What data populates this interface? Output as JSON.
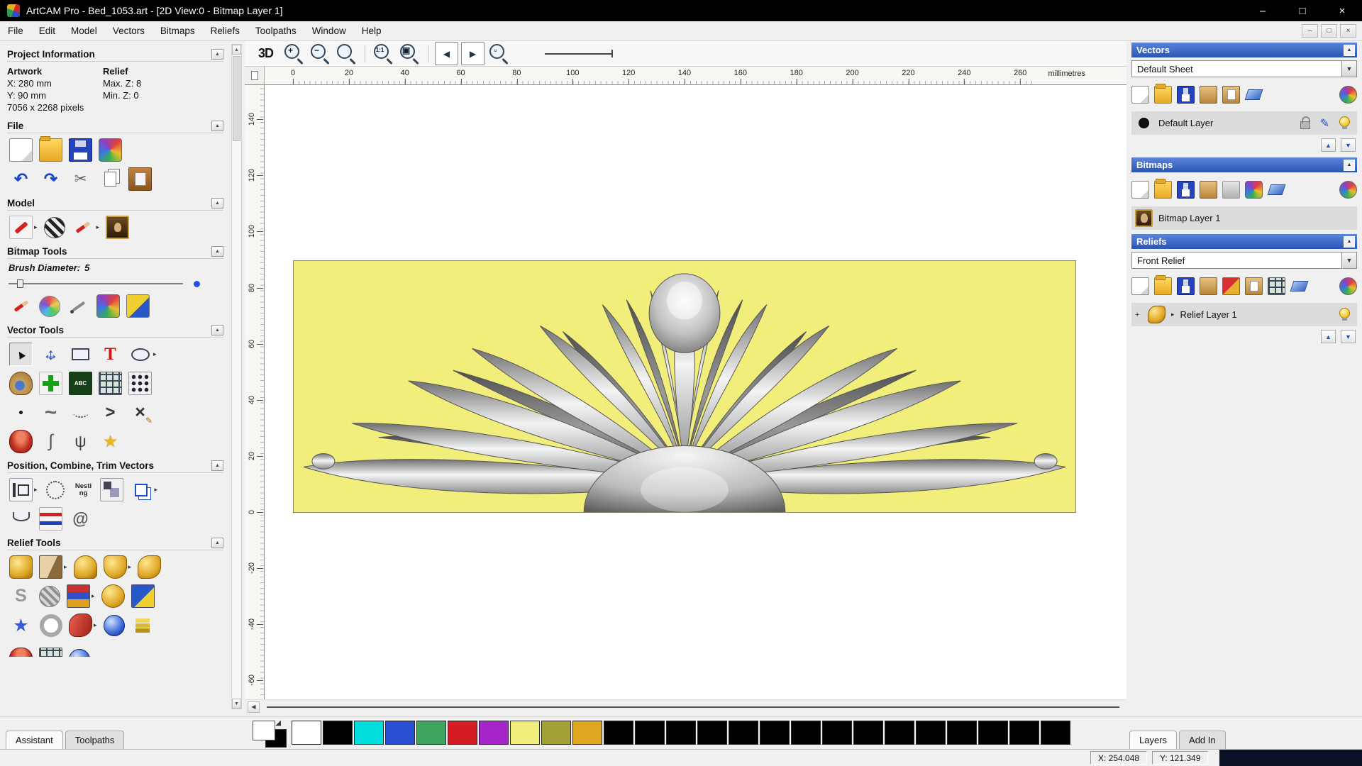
{
  "window": {
    "title": "ArtCAM Pro - Bed_1053.art - [2D View:0 - Bitmap Layer 1]",
    "menu_items": [
      "File",
      "Edit",
      "Model",
      "Vectors",
      "Bitmaps",
      "Reliefs",
      "Toolpaths",
      "Window",
      "Help"
    ]
  },
  "left_panel": {
    "project_info": {
      "title": "Project Information",
      "artwork_label": "Artwork",
      "relief_label": "Relief",
      "x": "X: 280 mm",
      "y": "Y: 90 mm",
      "max_z": "Max. Z: 8",
      "min_z": "Min. Z: 0",
      "pixels": "7056 x 2268 pixels"
    },
    "file": {
      "title": "File",
      "rows": [
        [
          "new-model:page",
          "open-model:folder",
          "save-model:floppy",
          "import-export:colorful"
        ],
        [
          "undo:undo",
          "redo:redo",
          "cut:cut",
          "copy:copy",
          "paste:paste"
        ]
      ]
    },
    "model": {
      "title": "Model",
      "rows": [
        [
          "set-model-size:redtool:arrow",
          "model-lighting:chess",
          "paint-from-model:brushred:arrow",
          "face-wizard:portrait"
        ]
      ]
    },
    "bitmap_tools": {
      "title": "Bitmap Tools",
      "brush_label": "Brush Diameter:",
      "brush_value": "5",
      "rows": [
        [
          "paint-brush:brushred",
          "draw-colour:palette",
          "colour-picker:dropper",
          "edit-palette:colorful",
          "flood-fill:bucket"
        ]
      ]
    },
    "vector_tools": {
      "title": "Vector Tools",
      "rows": [
        [
          "select-vectors:cursor-active",
          "transform-vectors:move",
          "create-rectangle:rect",
          "create-text:text",
          "create-ellipse:ellipse:arrow"
        ],
        [
          "create-freeform:snail",
          "create-cross:cross",
          "text-block:abc",
          "paste-along-curve:grid",
          "create-polygon:dots"
        ],
        [
          "create-point:dot",
          "free-polyline:wave",
          "create-bezier:dotcurve",
          "create-polyline:polyline",
          "node-editing:xpencil"
        ],
        [
          "create-disc:disc",
          "fit-curve:curve",
          "smooth-polyline:psi",
          "create-star:starpencil"
        ]
      ]
    },
    "position_tools": {
      "title": "Position, Combine, Trim Vectors",
      "nesting_text": "Nesting",
      "rows": [
        [
          "block-copy:measure:arrow",
          "rotate-copy:circledots",
          "nesting:nesting",
          "align-vectors:squares",
          "copy-objects:copies:arrow"
        ],
        [
          "fillet-tool:arc",
          "wrap-vectors:zigzag",
          "spiral-tool:spiral"
        ]
      ]
    },
    "relief_tools": {
      "title": "Relief Tools",
      "rows": [
        [
          "shape-editor:goldgear",
          "sculpting:chisel:arrow",
          "smooth-relief:goldtrophy",
          "texture-relief:goldcrown:arrow",
          "envelope-distortion:goldwave"
        ],
        [
          "two-rail-sweep:grays",
          "weave-wizard:woven",
          "relief-library:books:arrow",
          "paste-relief:goldpin",
          "constant-height:bluebox"
        ],
        [
          "star-wizard:bluestar",
          "texture-wizard:donut",
          "swept-profile:ribbon:arrow",
          "dome-wizard:sphere",
          "extrude-relief:layers"
        ]
      ],
      "clipped_rows": [
        [
          "clipped-tool-a:disc",
          "clipped-tool-b:grid",
          "clipped-tool-c:sphere"
        ]
      ]
    },
    "tabs": [
      {
        "label": "Assistant",
        "active": true
      },
      {
        "label": "Toolpaths",
        "active": false
      }
    ]
  },
  "canvas": {
    "toolbar": {
      "view3d_label": "3D"
    },
    "toolbar_icons": [
      [
        "zoom-in:zoomin",
        "zoom-out:zoomout",
        "zoom-previous:zoomobj",
        "|",
        "zoom-1to1:zoom11",
        "zoom-fit:zoomfit",
        "|",
        "page-left:pageleft",
        "page-right:pageright",
        "zoom-window:zoombox"
      ]
    ],
    "ruler_unit_label": "millimetres",
    "h_ticks": [
      0,
      20,
      40,
      60,
      80,
      100,
      120,
      140,
      160,
      180,
      200,
      220,
      240,
      260
    ],
    "v_ticks": [
      140,
      120,
      100,
      80,
      60,
      40,
      20,
      0,
      -20,
      -40,
      -60
    ],
    "artwork_bg": "#f2ee7c"
  },
  "right_panel": {
    "vectors": {
      "title": "Vectors",
      "sheet_value": "Default Sheet",
      "layer_name": "Default Layer",
      "toolbar": [
        [
          "new-vector-layer:page",
          "open-vector-layer:folder",
          "save-vector-layer:floppy",
          "import-vectors:tan",
          "export-vectors:tanpage",
          "clear-vector-layer:eraser",
          "|",
          "vector-layer-options:colorful2"
        ]
      ]
    },
    "bitmaps": {
      "title": "Bitmaps",
      "layer_name": "Bitmap Layer 1",
      "toolbar": [
        [
          "new-bitmap-layer:page",
          "open-bitmap-layer:folder",
          "save-bitmap-layer:floppy",
          "import-bitmap:tan",
          "bitmap-options:grayrow",
          "link-bitmap:colorful",
          "clear-bitmap-layer:eraser",
          "|",
          "bitmap-layer-options:colorful2"
        ]
      ]
    },
    "reliefs": {
      "title": "Reliefs",
      "dropdown_value": "Front Relief",
      "layer_name": "Relief Layer 1",
      "expand_glyph": "+",
      "toolbar": [
        [
          "new-relief-layer:page",
          "open-relief-layer:folder",
          "save-relief-layer:floppy",
          "import-relief:tan",
          "relief-wizard:redgold",
          "export-relief:tanpage",
          "relief-grid:grid2",
          "clear-relief-layer:eraser",
          "|",
          "relief-layer-options:colorful2"
        ]
      ]
    },
    "tabs": [
      {
        "label": "Layers",
        "active": true
      },
      {
        "label": "Add In",
        "active": false
      }
    ]
  },
  "palette": {
    "colors": [
      "#ffffff",
      "#000000",
      "#00dede",
      "#2a50d2",
      "#3ea55c",
      "#d41c24",
      "#a625c8",
      "#f2ee7c",
      "#a2a238",
      "#dfa71f",
      "#000000",
      "#000000",
      "#000000",
      "#000000",
      "#000000",
      "#000000",
      "#000000",
      "#000000",
      "#000000",
      "#000000",
      "#000000",
      "#000000",
      "#000000",
      "#000000",
      "#000000"
    ]
  },
  "status_bar": {
    "x": "X: 254.048",
    "y": "Y: 121.349"
  }
}
